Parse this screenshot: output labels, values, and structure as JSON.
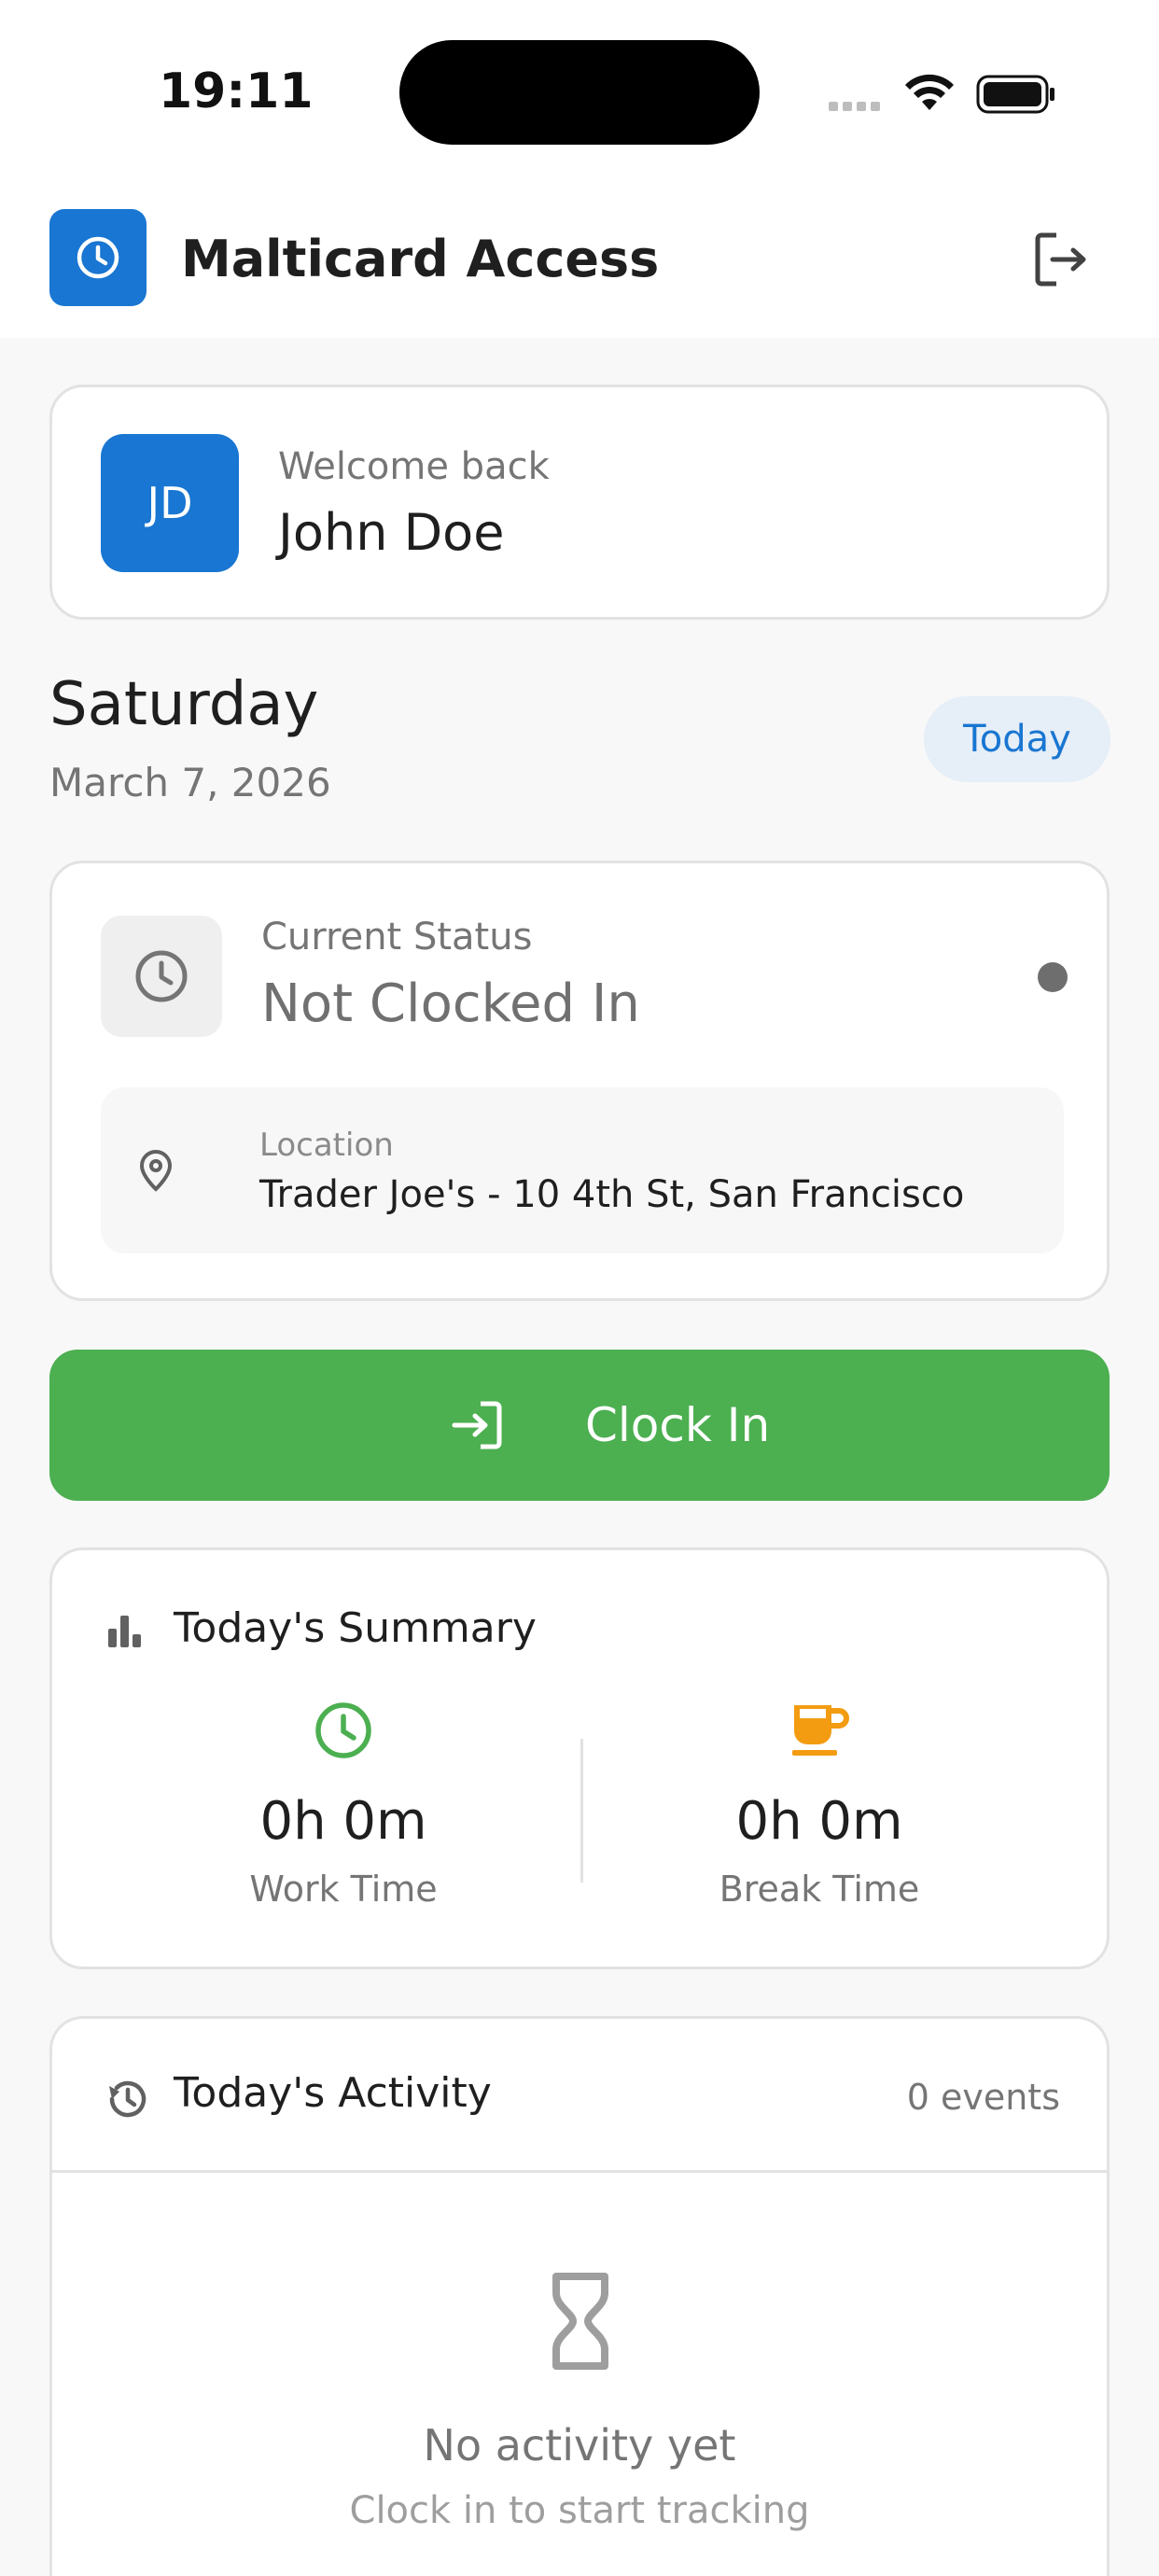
{
  "status_bar": {
    "time": "19:11"
  },
  "header": {
    "app_title": "Malticard Access",
    "logo_icon": "clock-icon",
    "logout_icon": "logout-icon",
    "brand_color": "#1976d2"
  },
  "welcome": {
    "avatar_initials": "JD",
    "greeting": "Welcome back",
    "name": "John Doe"
  },
  "date_section": {
    "day": "Saturday",
    "date": "March 7, 2026",
    "badge": "Today"
  },
  "status": {
    "label": "Current Status",
    "value": "Not Clocked In",
    "indicator_color": "#6e6e6e",
    "location_label": "Location",
    "location_value": "Trader Joe's - 10 4th St, San Francisco"
  },
  "clock_in": {
    "label": "Clock In",
    "color": "#4caf50"
  },
  "summary": {
    "title": "Today's Summary",
    "work": {
      "value": "0h 0m",
      "label": "Work Time",
      "icon_color": "#4caf50"
    },
    "break": {
      "value": "0h 0m",
      "label": "Break Time",
      "icon_color": "#f39c12"
    }
  },
  "activity": {
    "title": "Today's Activity",
    "count": "0 events",
    "empty_title": "No activity yet",
    "empty_subtitle": "Clock in to start tracking"
  }
}
